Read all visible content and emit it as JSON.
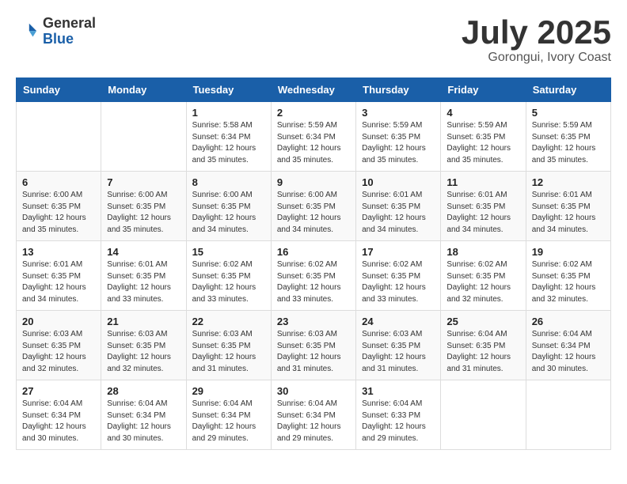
{
  "header": {
    "logo_general": "General",
    "logo_blue": "Blue",
    "month": "July 2025",
    "location": "Gorongui, Ivory Coast"
  },
  "weekdays": [
    "Sunday",
    "Monday",
    "Tuesday",
    "Wednesday",
    "Thursday",
    "Friday",
    "Saturday"
  ],
  "weeks": [
    [
      {
        "day": "",
        "info": ""
      },
      {
        "day": "",
        "info": ""
      },
      {
        "day": "1",
        "info": "Sunrise: 5:58 AM\nSunset: 6:34 PM\nDaylight: 12 hours and 35 minutes."
      },
      {
        "day": "2",
        "info": "Sunrise: 5:59 AM\nSunset: 6:34 PM\nDaylight: 12 hours and 35 minutes."
      },
      {
        "day": "3",
        "info": "Sunrise: 5:59 AM\nSunset: 6:35 PM\nDaylight: 12 hours and 35 minutes."
      },
      {
        "day": "4",
        "info": "Sunrise: 5:59 AM\nSunset: 6:35 PM\nDaylight: 12 hours and 35 minutes."
      },
      {
        "day": "5",
        "info": "Sunrise: 5:59 AM\nSunset: 6:35 PM\nDaylight: 12 hours and 35 minutes."
      }
    ],
    [
      {
        "day": "6",
        "info": "Sunrise: 6:00 AM\nSunset: 6:35 PM\nDaylight: 12 hours and 35 minutes."
      },
      {
        "day": "7",
        "info": "Sunrise: 6:00 AM\nSunset: 6:35 PM\nDaylight: 12 hours and 35 minutes."
      },
      {
        "day": "8",
        "info": "Sunrise: 6:00 AM\nSunset: 6:35 PM\nDaylight: 12 hours and 34 minutes."
      },
      {
        "day": "9",
        "info": "Sunrise: 6:00 AM\nSunset: 6:35 PM\nDaylight: 12 hours and 34 minutes."
      },
      {
        "day": "10",
        "info": "Sunrise: 6:01 AM\nSunset: 6:35 PM\nDaylight: 12 hours and 34 minutes."
      },
      {
        "day": "11",
        "info": "Sunrise: 6:01 AM\nSunset: 6:35 PM\nDaylight: 12 hours and 34 minutes."
      },
      {
        "day": "12",
        "info": "Sunrise: 6:01 AM\nSunset: 6:35 PM\nDaylight: 12 hours and 34 minutes."
      }
    ],
    [
      {
        "day": "13",
        "info": "Sunrise: 6:01 AM\nSunset: 6:35 PM\nDaylight: 12 hours and 34 minutes."
      },
      {
        "day": "14",
        "info": "Sunrise: 6:01 AM\nSunset: 6:35 PM\nDaylight: 12 hours and 33 minutes."
      },
      {
        "day": "15",
        "info": "Sunrise: 6:02 AM\nSunset: 6:35 PM\nDaylight: 12 hours and 33 minutes."
      },
      {
        "day": "16",
        "info": "Sunrise: 6:02 AM\nSunset: 6:35 PM\nDaylight: 12 hours and 33 minutes."
      },
      {
        "day": "17",
        "info": "Sunrise: 6:02 AM\nSunset: 6:35 PM\nDaylight: 12 hours and 33 minutes."
      },
      {
        "day": "18",
        "info": "Sunrise: 6:02 AM\nSunset: 6:35 PM\nDaylight: 12 hours and 32 minutes."
      },
      {
        "day": "19",
        "info": "Sunrise: 6:02 AM\nSunset: 6:35 PM\nDaylight: 12 hours and 32 minutes."
      }
    ],
    [
      {
        "day": "20",
        "info": "Sunrise: 6:03 AM\nSunset: 6:35 PM\nDaylight: 12 hours and 32 minutes."
      },
      {
        "day": "21",
        "info": "Sunrise: 6:03 AM\nSunset: 6:35 PM\nDaylight: 12 hours and 32 minutes."
      },
      {
        "day": "22",
        "info": "Sunrise: 6:03 AM\nSunset: 6:35 PM\nDaylight: 12 hours and 31 minutes."
      },
      {
        "day": "23",
        "info": "Sunrise: 6:03 AM\nSunset: 6:35 PM\nDaylight: 12 hours and 31 minutes."
      },
      {
        "day": "24",
        "info": "Sunrise: 6:03 AM\nSunset: 6:35 PM\nDaylight: 12 hours and 31 minutes."
      },
      {
        "day": "25",
        "info": "Sunrise: 6:04 AM\nSunset: 6:35 PM\nDaylight: 12 hours and 31 minutes."
      },
      {
        "day": "26",
        "info": "Sunrise: 6:04 AM\nSunset: 6:34 PM\nDaylight: 12 hours and 30 minutes."
      }
    ],
    [
      {
        "day": "27",
        "info": "Sunrise: 6:04 AM\nSunset: 6:34 PM\nDaylight: 12 hours and 30 minutes."
      },
      {
        "day": "28",
        "info": "Sunrise: 6:04 AM\nSunset: 6:34 PM\nDaylight: 12 hours and 30 minutes."
      },
      {
        "day": "29",
        "info": "Sunrise: 6:04 AM\nSunset: 6:34 PM\nDaylight: 12 hours and 29 minutes."
      },
      {
        "day": "30",
        "info": "Sunrise: 6:04 AM\nSunset: 6:34 PM\nDaylight: 12 hours and 29 minutes."
      },
      {
        "day": "31",
        "info": "Sunrise: 6:04 AM\nSunset: 6:33 PM\nDaylight: 12 hours and 29 minutes."
      },
      {
        "day": "",
        "info": ""
      },
      {
        "day": "",
        "info": ""
      }
    ]
  ]
}
